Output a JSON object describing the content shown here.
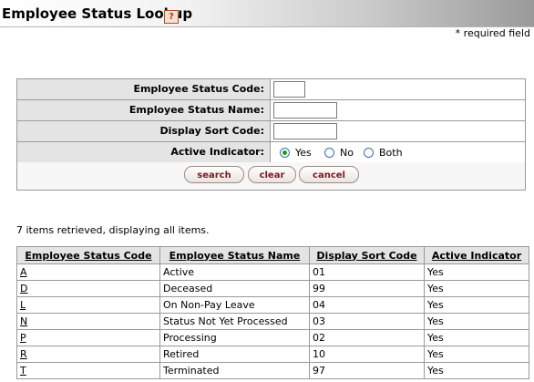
{
  "header": {
    "title": "Employee Status Lookup",
    "help_icon_glyph": "?"
  },
  "required_note": "* required field",
  "form": {
    "fields": [
      {
        "label": "Employee Status Code:",
        "value": ""
      },
      {
        "label": "Employee Status Name:",
        "value": ""
      },
      {
        "label": "Display Sort Code:",
        "value": ""
      }
    ],
    "active_indicator": {
      "label": "Active Indicator:",
      "options": [
        "Yes",
        "No",
        "Both"
      ],
      "selected": "Yes"
    },
    "buttons": {
      "search": "search",
      "clear": "clear",
      "cancel": "cancel"
    }
  },
  "results": {
    "summary": "7 items retrieved, displaying all items.",
    "columns": [
      "Employee Status Code",
      "Employee Status Name",
      "Display Sort Code",
      "Active Indicator"
    ],
    "rows": [
      [
        "A",
        "Active",
        "01",
        "Yes"
      ],
      [
        "D",
        "Deceased",
        "99",
        "Yes"
      ],
      [
        "L",
        "On Non-Pay Leave",
        "04",
        "Yes"
      ],
      [
        "N",
        "Status Not Yet Processed",
        "03",
        "Yes"
      ],
      [
        "P",
        "Processing",
        "02",
        "Yes"
      ],
      [
        "R",
        "Retired",
        "10",
        "Yes"
      ],
      [
        "T",
        "Terminated",
        "97",
        "Yes"
      ]
    ]
  },
  "colors": {
    "selected_radio": "#1f9a20",
    "button_text": "#7a1a1a",
    "label_bg": "#e4e4e4"
  }
}
